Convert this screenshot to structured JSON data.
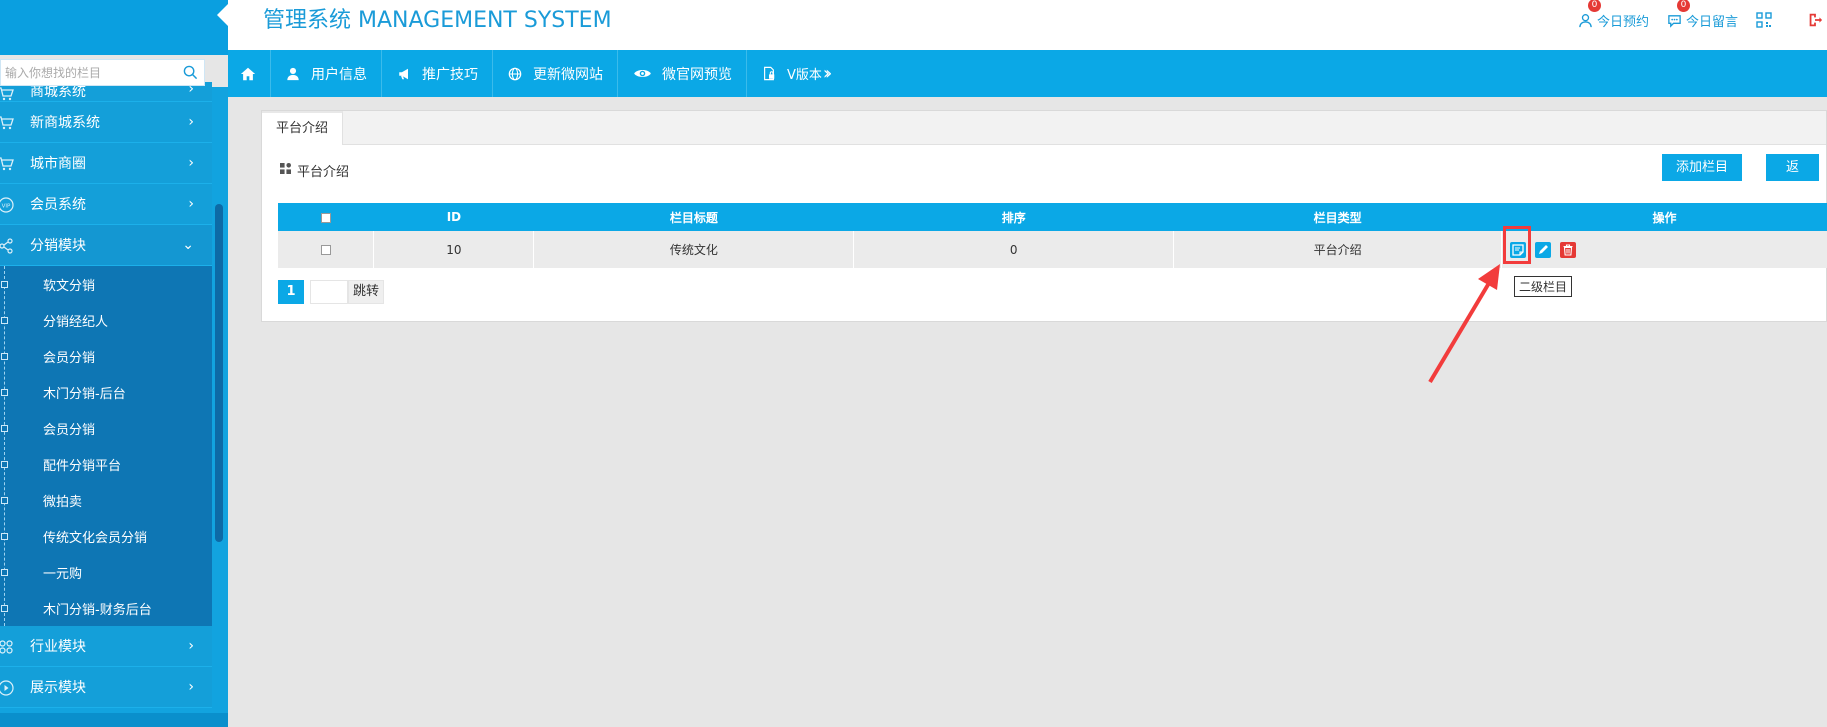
{
  "header": {
    "title": "管理系统 MANAGEMENT SYSTEM",
    "appointments_label": "今日预约",
    "appointments_badge": "0",
    "messages_label": "今日留言",
    "messages_badge": "0"
  },
  "sidebar": {
    "search_placeholder": "输入你想找的栏目",
    "clipped_item": "商城系统",
    "items": [
      {
        "label": "新商城系统"
      },
      {
        "label": "城市商圈"
      },
      {
        "label": "会员系统"
      },
      {
        "label": "分销模块"
      }
    ],
    "sub_items": [
      {
        "label": "软文分销"
      },
      {
        "label": "分销经纪人"
      },
      {
        "label": "会员分销"
      },
      {
        "label": "木门分销-后台"
      },
      {
        "label": "会员分销"
      },
      {
        "label": "配件分销平台"
      },
      {
        "label": "微拍卖"
      },
      {
        "label": "传统文化会员分销"
      },
      {
        "label": "一元购"
      },
      {
        "label": "木门分销-财务后台"
      }
    ],
    "after_items": [
      {
        "label": "行业模块"
      },
      {
        "label": "展示模块"
      }
    ]
  },
  "topnav": {
    "items": [
      {
        "label": "用户信息"
      },
      {
        "label": "推广技巧"
      },
      {
        "label": "更新微网站"
      },
      {
        "label": "微官网预览"
      },
      {
        "label": "V版本"
      }
    ]
  },
  "content": {
    "tab": "平台介绍",
    "section_title": "平台介绍",
    "add_button": "添加栏目",
    "back_button": "返回",
    "table": {
      "headers": [
        "ID",
        "栏目标题",
        "排序",
        "栏目类型",
        "操作"
      ],
      "rows": [
        {
          "id": "10",
          "title": "传统文化",
          "sort": "0",
          "type": "平台介绍"
        }
      ]
    },
    "tooltip": "二级栏目",
    "pager": {
      "current": "1",
      "go_label": "跳转"
    }
  },
  "colors": {
    "primary": "#0ba8e6",
    "danger": "#e53935",
    "annotation": "#f23c3c"
  }
}
